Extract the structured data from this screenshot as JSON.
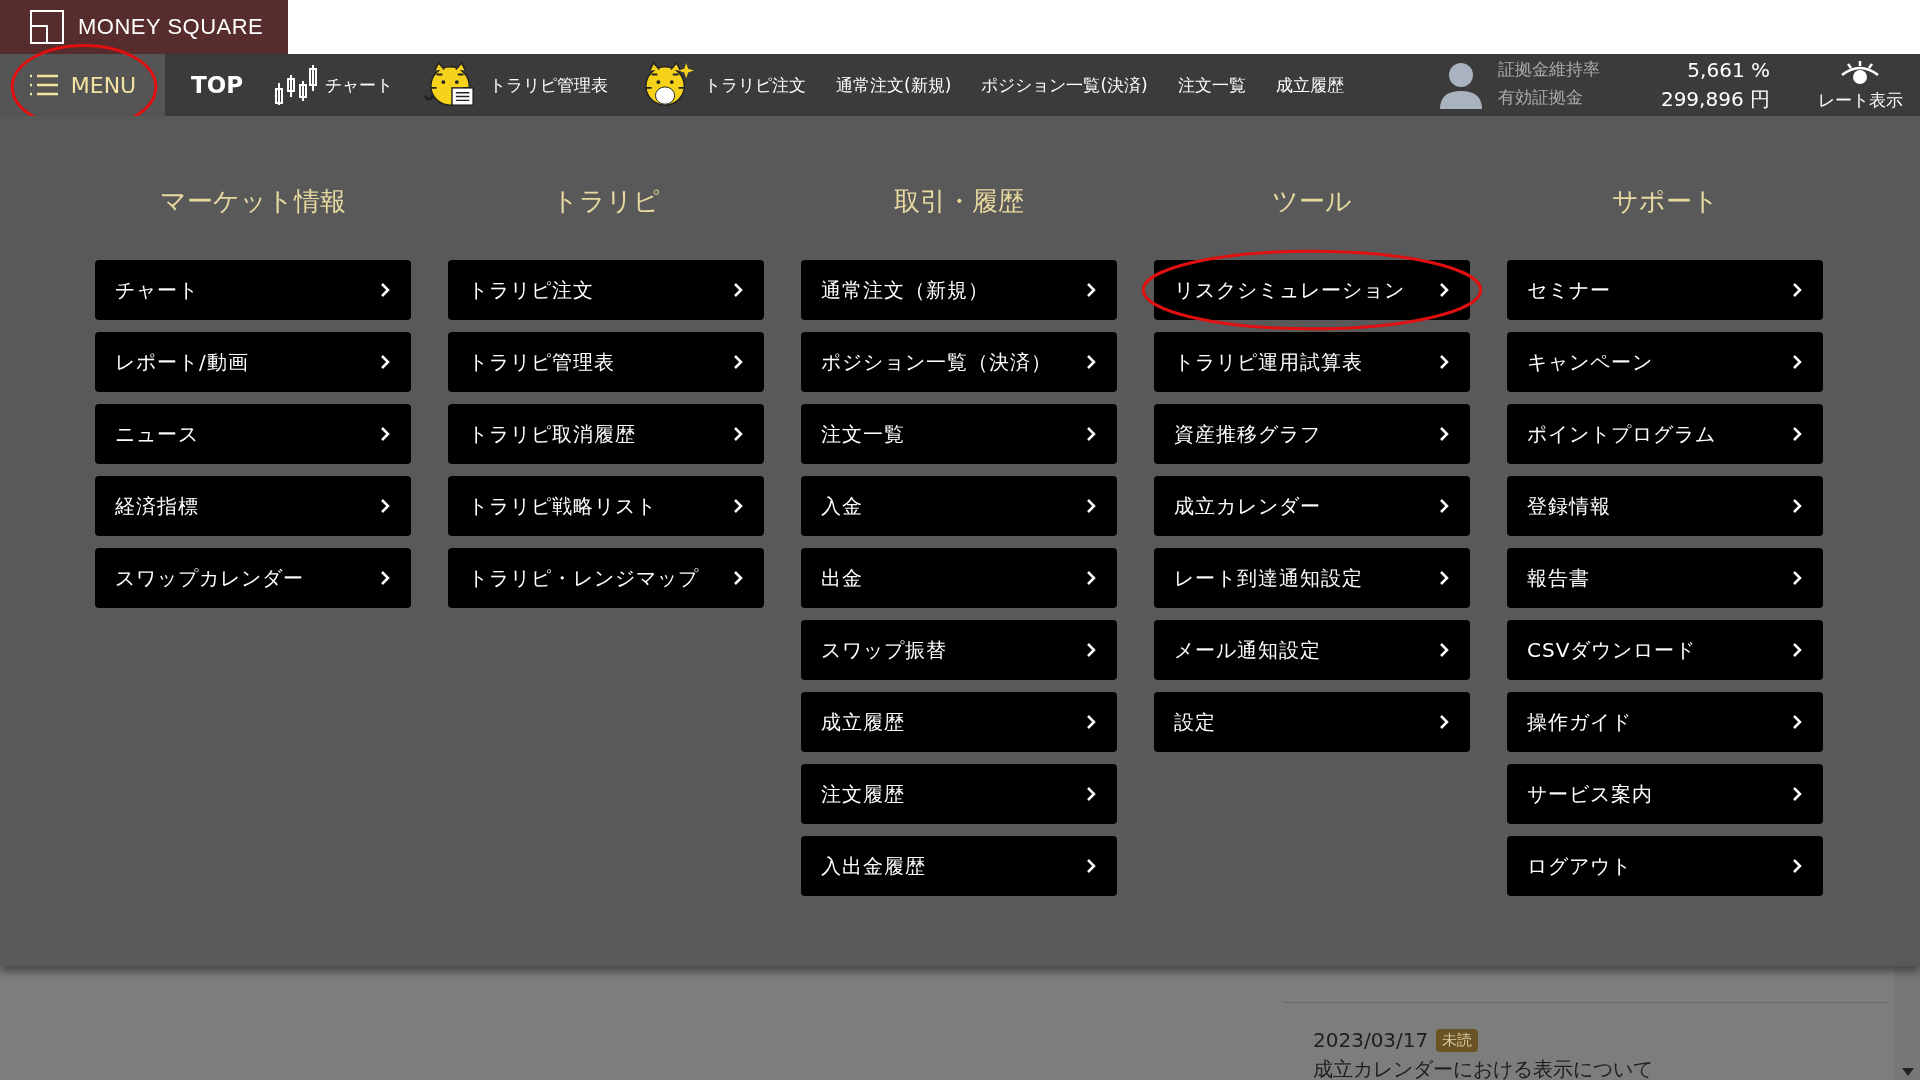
{
  "brand": {
    "name": "MONEY SQUARE"
  },
  "menu_button": {
    "label": "MENU",
    "highlighted": true
  },
  "nav": [
    {
      "label": "TOP",
      "kind": "plain"
    },
    {
      "label": "チャート",
      "kind": "chart"
    },
    {
      "label": "トラリピ管理表",
      "kind": "tiger-sheet"
    },
    {
      "label": "トラリピ注文",
      "kind": "tiger"
    },
    {
      "label": "通常注文(新規)",
      "kind": "text"
    },
    {
      "label": "ポジション一覧(決済)",
      "kind": "text"
    },
    {
      "label": "注文一覧",
      "kind": "text"
    },
    {
      "label": "成立履歴",
      "kind": "text"
    }
  ],
  "account": [
    {
      "label": "証拠金維持率",
      "value": "5,661",
      "unit": "%"
    },
    {
      "label": "有効証拠金",
      "value": "299,896",
      "unit": "円"
    }
  ],
  "rate_toggle": {
    "label": "レート表示"
  },
  "menu_columns": [
    {
      "heading": "マーケット情報",
      "items": [
        {
          "label": "チャート",
          "highlighted": false
        },
        {
          "label": "レポート/動画",
          "highlighted": false
        },
        {
          "label": "ニュース",
          "highlighted": false
        },
        {
          "label": "経済指標",
          "highlighted": false
        },
        {
          "label": "スワップカレンダー",
          "highlighted": false
        }
      ]
    },
    {
      "heading": "トラリピ",
      "items": [
        {
          "label": "トラリピ注文",
          "highlighted": false
        },
        {
          "label": "トラリピ管理表",
          "highlighted": false
        },
        {
          "label": "トラリピ取消履歴",
          "highlighted": false
        },
        {
          "label": "トラリピ戦略リスト",
          "highlighted": false
        },
        {
          "label": "トラリピ・レンジマップ",
          "highlighted": false
        }
      ]
    },
    {
      "heading": "取引・履歴",
      "items": [
        {
          "label": "通常注文（新規）",
          "highlighted": false
        },
        {
          "label": "ポジション一覧（決済）",
          "highlighted": false
        },
        {
          "label": "注文一覧",
          "highlighted": false
        },
        {
          "label": "入金",
          "highlighted": false
        },
        {
          "label": "出金",
          "highlighted": false
        },
        {
          "label": "スワップ振替",
          "highlighted": false
        },
        {
          "label": "成立履歴",
          "highlighted": false
        },
        {
          "label": "注文履歴",
          "highlighted": false
        },
        {
          "label": "入出金履歴",
          "highlighted": false
        }
      ]
    },
    {
      "heading": "ツール",
      "items": [
        {
          "label": "リスクシミュレーション",
          "highlighted": true
        },
        {
          "label": "トラリピ運用試算表",
          "highlighted": false
        },
        {
          "label": "資産推移グラフ",
          "highlighted": false
        },
        {
          "label": "成立カレンダー",
          "highlighted": false
        },
        {
          "label": "レート到達通知設定",
          "highlighted": false
        },
        {
          "label": "メール通知設定",
          "highlighted": false
        },
        {
          "label": "設定",
          "highlighted": false
        }
      ]
    },
    {
      "heading": "サポート",
      "items": [
        {
          "label": "セミナー",
          "highlighted": false
        },
        {
          "label": "キャンペーン",
          "highlighted": false
        },
        {
          "label": "ポイントプログラム",
          "highlighted": false
        },
        {
          "label": "登録情報",
          "highlighted": false
        },
        {
          "label": "報告書",
          "highlighted": false
        },
        {
          "label": "CSVダウンロード",
          "highlighted": false
        },
        {
          "label": "操作ガイド",
          "highlighted": false
        },
        {
          "label": "サービス案内",
          "highlighted": false
        },
        {
          "label": "ログアウト",
          "highlighted": false
        }
      ]
    }
  ],
  "news": {
    "date": "2023/03/17",
    "badge": "未読",
    "title": "成立カレンダーにおける表示について"
  }
}
